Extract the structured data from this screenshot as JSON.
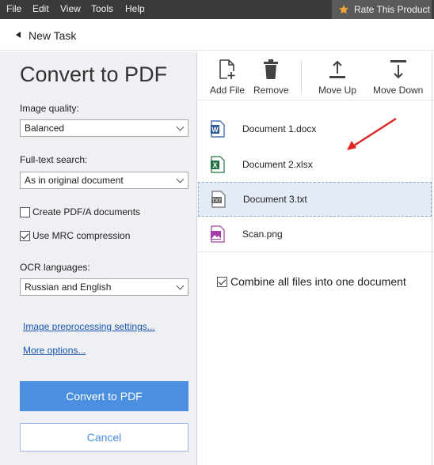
{
  "menu": {
    "items": [
      "File",
      "Edit",
      "View",
      "Tools",
      "Help"
    ],
    "rate_label": "Rate This Product"
  },
  "task": {
    "title": "New Task"
  },
  "left": {
    "title": "Convert to PDF",
    "image_quality": {
      "label": "Image quality:",
      "value": "Balanced"
    },
    "fulltext": {
      "label": "Full-text search:",
      "value": "As in original document"
    },
    "create_pdfa": {
      "label": "Create PDF/A documents",
      "checked": false
    },
    "use_mrc": {
      "label": "Use MRC compression",
      "checked": true
    },
    "ocr": {
      "label": "OCR languages:",
      "value": "Russian and English"
    },
    "links": {
      "preprocessing": "Image preprocessing settings...",
      "more": "More options..."
    },
    "convert_label": "Convert to PDF",
    "cancel_label": "Cancel"
  },
  "toolbar": {
    "add_file": "Add File",
    "remove": "Remove",
    "move_up": "Move Up",
    "move_down": "Move Down"
  },
  "files": [
    {
      "name": "Document 1.docx",
      "icon": "word-doc-icon",
      "color": "#2b579a"
    },
    {
      "name": "Document 2.xlsx",
      "icon": "excel-doc-icon",
      "color": "#217346"
    },
    {
      "name": "Document 3.txt",
      "icon": "text-doc-icon",
      "color": "#6b6b6b"
    },
    {
      "name": "Scan.png",
      "icon": "image-doc-icon",
      "color": "#a23ea6"
    }
  ],
  "combine": {
    "label": "Combine all files into one document",
    "checked": true
  },
  "colors": {
    "accent": "#4a8fe0",
    "menubar": "#3a3a3a",
    "annotation": "#e02424"
  }
}
